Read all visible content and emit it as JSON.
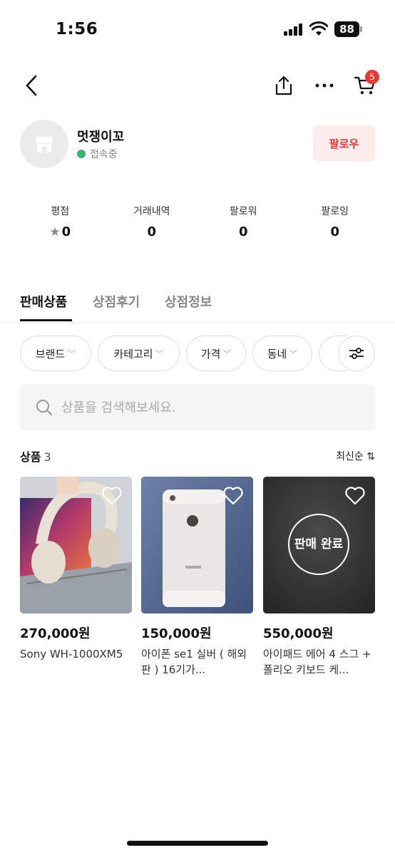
{
  "status_bar": {
    "time": "1:56",
    "battery": "88"
  },
  "nav": {
    "cart_badge": "5"
  },
  "profile": {
    "shop_name": "멋쟁이꼬",
    "online_status": "접속중",
    "follow_label": "팔로우"
  },
  "stats": [
    {
      "label": "평점",
      "value": "0"
    },
    {
      "label": "거래내역",
      "value": "0"
    },
    {
      "label": "팔로워",
      "value": "0"
    },
    {
      "label": "팔로잉",
      "value": "0"
    }
  ],
  "tabs": [
    {
      "label": "판매상품",
      "active": true
    },
    {
      "label": "상점후기",
      "active": false
    },
    {
      "label": "상점정보",
      "active": false
    }
  ],
  "filters": [
    "브랜드",
    "카테고리",
    "가격",
    "동네"
  ],
  "search": {
    "placeholder": "상품을 검색해보세요."
  },
  "products_header": {
    "label": "상품",
    "count": "3",
    "sort": "최신순"
  },
  "products": [
    {
      "price": "270,000원",
      "title": "Sony WH-1000XM5",
      "sold_label": ""
    },
    {
      "price": "150,000원",
      "title": "아이폰 se1 실버 ( 해외판 ) 16기가...",
      "sold_label": ""
    },
    {
      "price": "550,000원",
      "title": "아이패드 에어 4 스그 + 폴리오 키보드 케...",
      "sold_label": "판매 완료"
    }
  ],
  "colors": {
    "accent_red": "#e53935",
    "online_green": "#3cb371"
  }
}
